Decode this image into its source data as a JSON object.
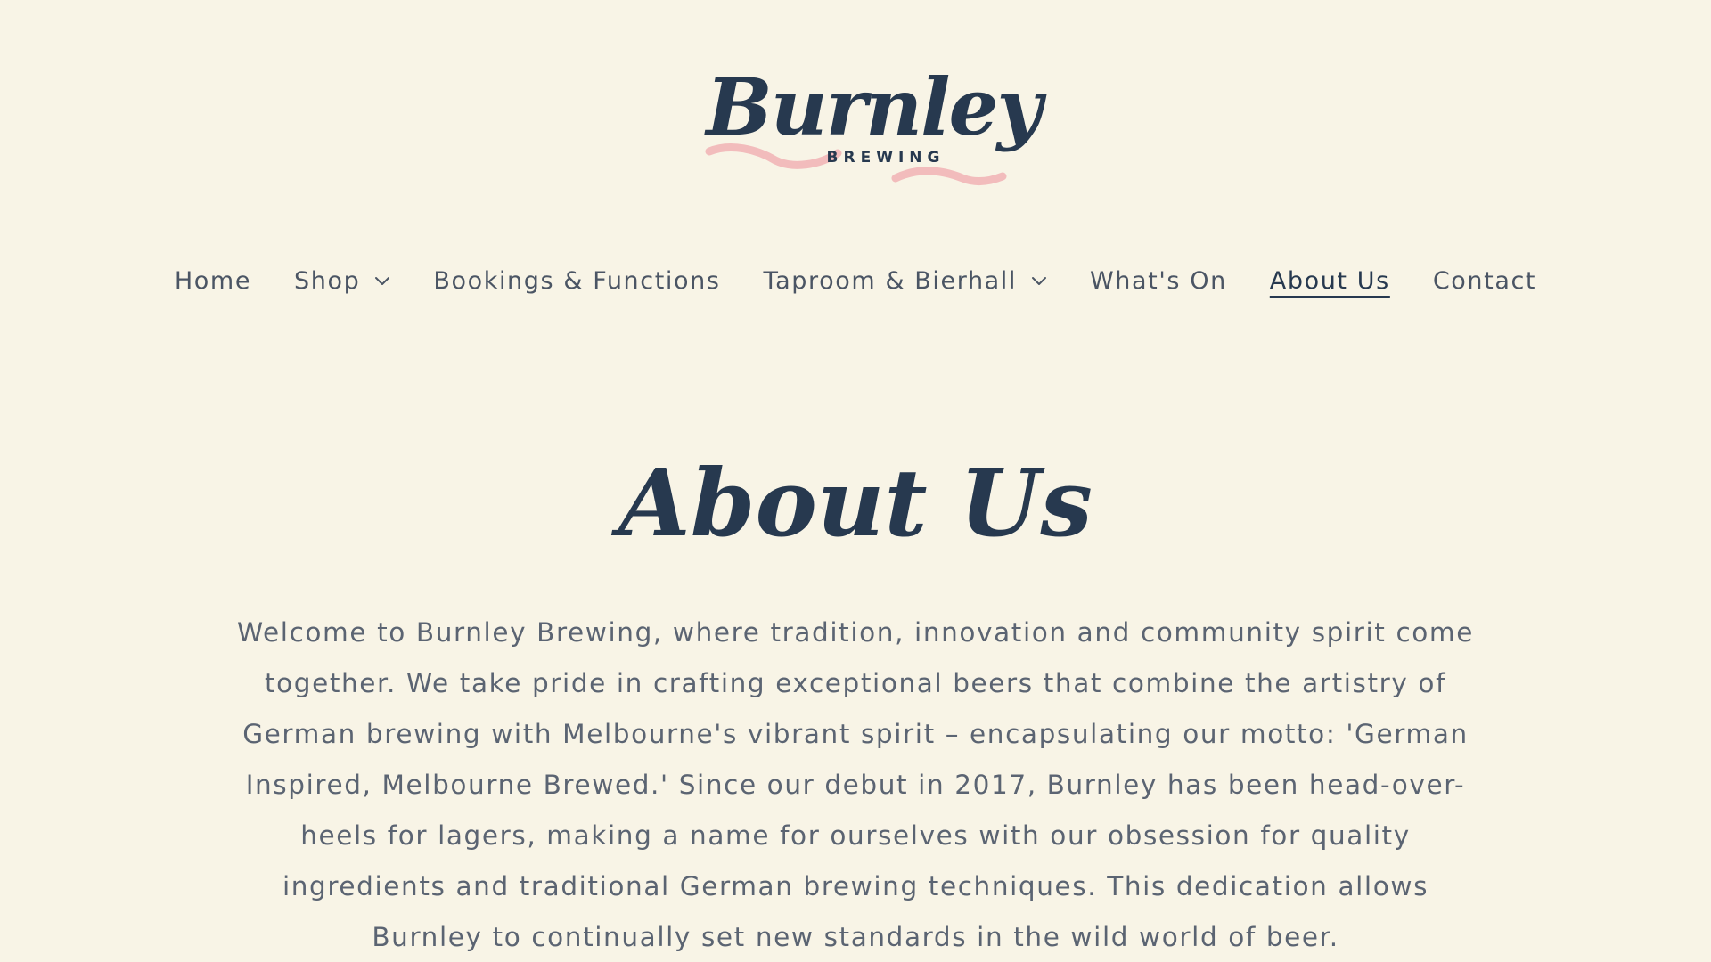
{
  "brand": {
    "name": "Burnley",
    "sub": "BREWING",
    "colors": {
      "background": "#f8f4e6",
      "navy": "#27394f",
      "text": "#5b6472",
      "accent_pink": "#f2bcbc"
    }
  },
  "nav": {
    "items": [
      {
        "label": "Home",
        "dropdown": false,
        "active": false
      },
      {
        "label": "Shop",
        "dropdown": true,
        "active": false
      },
      {
        "label": "Bookings & Functions",
        "dropdown": false,
        "active": false
      },
      {
        "label": "Taproom & Bierhall",
        "dropdown": true,
        "active": false
      },
      {
        "label": "What's On",
        "dropdown": false,
        "active": false
      },
      {
        "label": "About Us",
        "dropdown": false,
        "active": true
      },
      {
        "label": "Contact",
        "dropdown": false,
        "active": false
      }
    ]
  },
  "page": {
    "title": "About Us",
    "body": "Welcome to Burnley Brewing, where tradition, innovation and community spirit come together. We take pride in crafting exceptional beers that combine the artistry of German brewing with Melbourne's vibrant spirit – encapsulating our motto: 'German Inspired, Melbourne Brewed.' Since our debut in 2017, Burnley has been head-over-heels for lagers, making a name for ourselves with our obsession for quality ingredients and traditional German brewing techniques. This dedication allows Burnley to continually set new standards in the wild world of beer."
  }
}
